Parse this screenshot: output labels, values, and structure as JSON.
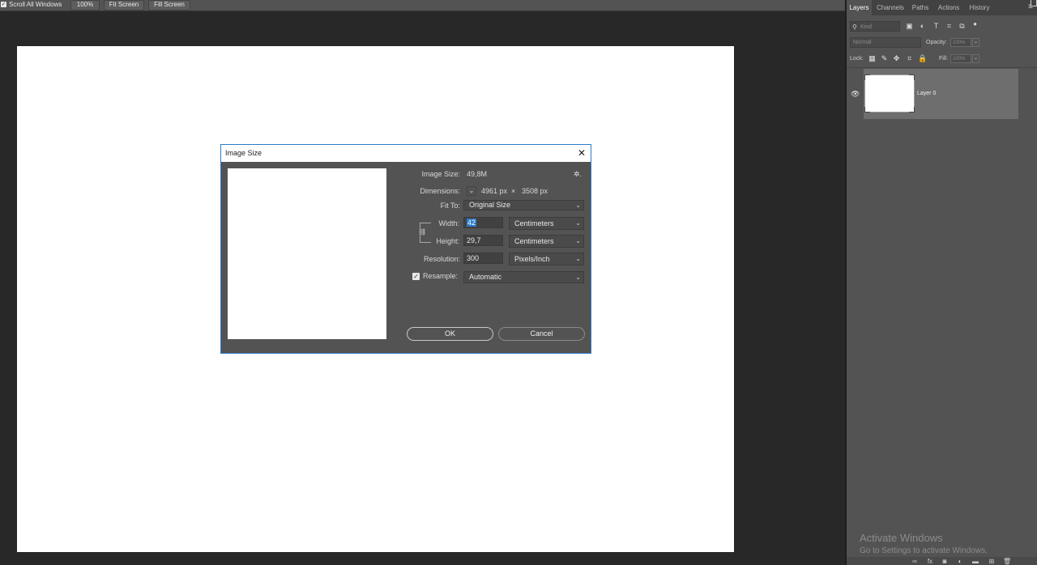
{
  "optionsbar": {
    "scroll_all_windows": "Scroll All Windows",
    "scroll_all_checked": true,
    "zoom_100": "100%",
    "fit_screen": "Fit Screen",
    "fill_screen": "Fill Screen"
  },
  "panel": {
    "tabs": [
      "Layers",
      "Channels",
      "Paths",
      "Actions",
      "History"
    ],
    "active_tab": "Layers",
    "kind_placeholder": "Kind",
    "blend_mode": "Normal",
    "opacity_label": "Opacity:",
    "opacity_value": "100%",
    "lock_label": "Lock:",
    "fill_label": "Fill:",
    "fill_value": "100%",
    "layers": [
      {
        "name": "Layer 0",
        "visible": true
      }
    ]
  },
  "watermark": {
    "line1": "Activate Windows",
    "line2": "Go to Settings to activate Windows."
  },
  "dialog": {
    "title": "Image Size",
    "image_size_label": "Image Size:",
    "image_size_value": "49,8M",
    "dimensions_label": "Dimensions:",
    "dimensions_w": "4961 px",
    "dimensions_x": "×",
    "dimensions_h": "3508 px",
    "fit_to_label": "Fit To:",
    "fit_to_value": "Original Size",
    "width_label": "Width:",
    "width_value": "42",
    "width_unit": "Centimeters",
    "height_label": "Height:",
    "height_value": "29,7",
    "height_unit": "Centimeters",
    "resolution_label": "Resolution:",
    "resolution_value": "300",
    "resolution_unit": "Pixels/Inch",
    "resample_label": "Resample:",
    "resample_checked": true,
    "resample_value": "Automatic",
    "ok_label": "OK",
    "cancel_label": "Cancel"
  },
  "colors": {
    "accent": "#2d7ac7",
    "workspace": "#282828",
    "panel": "#535353"
  }
}
